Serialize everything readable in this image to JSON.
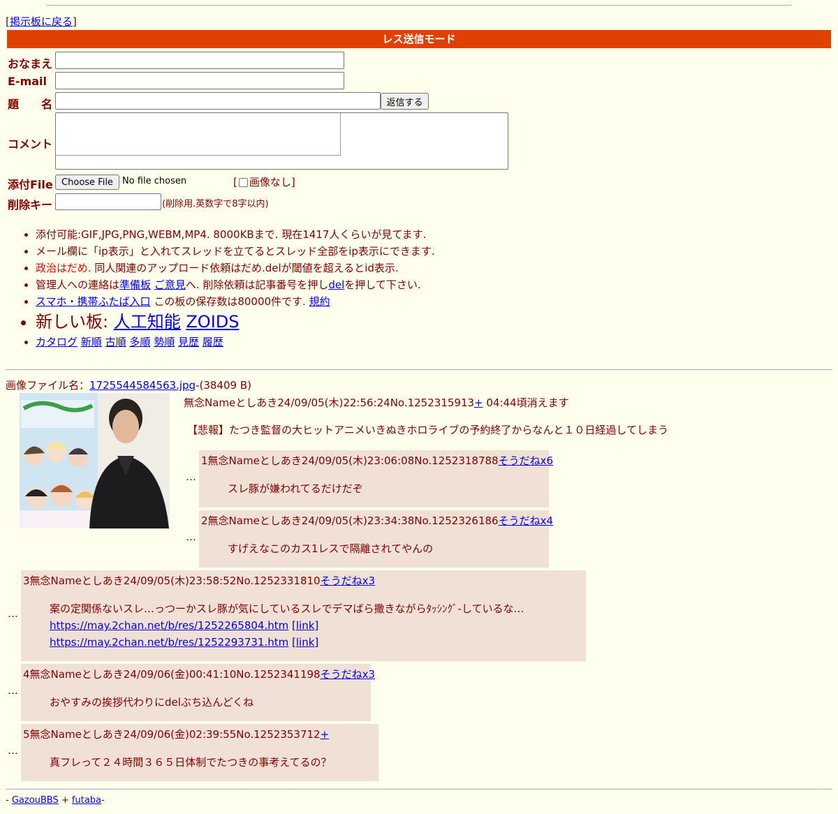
{
  "nav": {
    "back_link": "掲示板に戻る"
  },
  "form": {
    "banner": "レス送信モード",
    "name_label": "おなまえ",
    "email_label": "E-mail",
    "subject_label": "題　　名",
    "submit_label": "返信する",
    "comment_label": "コメント",
    "file_label": "添付File",
    "choose_file": "Choose File",
    "no_file": "No file chosen",
    "no_image_label": "画像なし",
    "delkey_label": "削除キー",
    "delkey_note": "(削除用.英数字で8字以内)"
  },
  "rules": {
    "r1": "添付可能:GIF,JPG,PNG,WEBM,MP4. 8000KBまで. 現在1417人くらいが見てます.",
    "r2": "メール欄に「ip表示」と入れてスレッドを立てるとスレッド全部をip表示にできます.",
    "r3_red": "政治はだめ.",
    "r3_rest": " 同人関連のアップロード依頼はだめ.delが閾値を超えるとid表示.",
    "r4_a": "管理人への連絡は",
    "r4_link1": "準備板",
    "r4_link2": "ご意見",
    "r4_b": "へ. 削除依頼は記事番号を押し",
    "r4_link3": "del",
    "r4_c": "を押して下さい.",
    "r5_link1": "スマホ・携帯ふたば入口",
    "r5_text": " この板の保存数は80000件です. ",
    "r5_link2": "規約",
    "r6_text": "新しい板: ",
    "r6_link1": "人工知能",
    "r6_link2": "ZOIDS",
    "r7_links": [
      "カタログ",
      "新順",
      "古順",
      "多順",
      "勢順",
      "見歴",
      "履歴"
    ]
  },
  "thread": {
    "file_label": "画像ファイル名：",
    "file_name": "1725544584563.jpg",
    "file_size": "-(38409 B)",
    "op_header": "無念Nameとしあき24/09/05(木)22:56:24No.1252315913",
    "op_plus": "+",
    "op_expire": " 04:44頃消えます",
    "op_body": "【悲報】たつき監督の大ヒットアニメいきぬきホロライブの予約終了からなんと１０日経過してしまう",
    "replies": [
      {
        "header": "1無念Nameとしあき24/09/05(木)23:06:08No.1252318788",
        "sodane": "そうだねx6",
        "body": "スレ豚が嫌われてるだけだぞ"
      },
      {
        "header": "2無念Nameとしあき24/09/05(木)23:34:38No.1252326186",
        "sodane": "そうだねx4",
        "body": "すげえなこのカス1レスで隔離されてやんの"
      },
      {
        "header": "3無念Nameとしあき24/09/05(木)23:58:52No.1252331810",
        "sodane": "そうだねx3",
        "body": "案の定関係ないスレ…っつーかスレ豚が気にしているスレでデマばら撒きながらﾀｯｼﾝｸﾞ-しているな…",
        "link1": "https://may.2chan.net/b/res/1252265804.htm",
        "link2": "https://may.2chan.net/b/res/1252293731.htm",
        "link_tag": "[link]"
      },
      {
        "header": "4無念Nameとしあき24/09/06(金)00:41:10No.1252341198",
        "sodane": "そうだねx3",
        "body": "おやすみの挨拶代わりにdelぶち込んどくね"
      },
      {
        "header": "5無念Nameとしあき24/09/06(金)02:39:55No.1252353712",
        "sodane": "+",
        "body": "真フレって２４時間３６５日体制でたつきの事考えてるの？"
      }
    ],
    "ellipsis": "…"
  },
  "footer": {
    "prefix": "- ",
    "link1": "GazouBBS",
    "plus": " + ",
    "link2": "futaba",
    "suffix": "-"
  }
}
